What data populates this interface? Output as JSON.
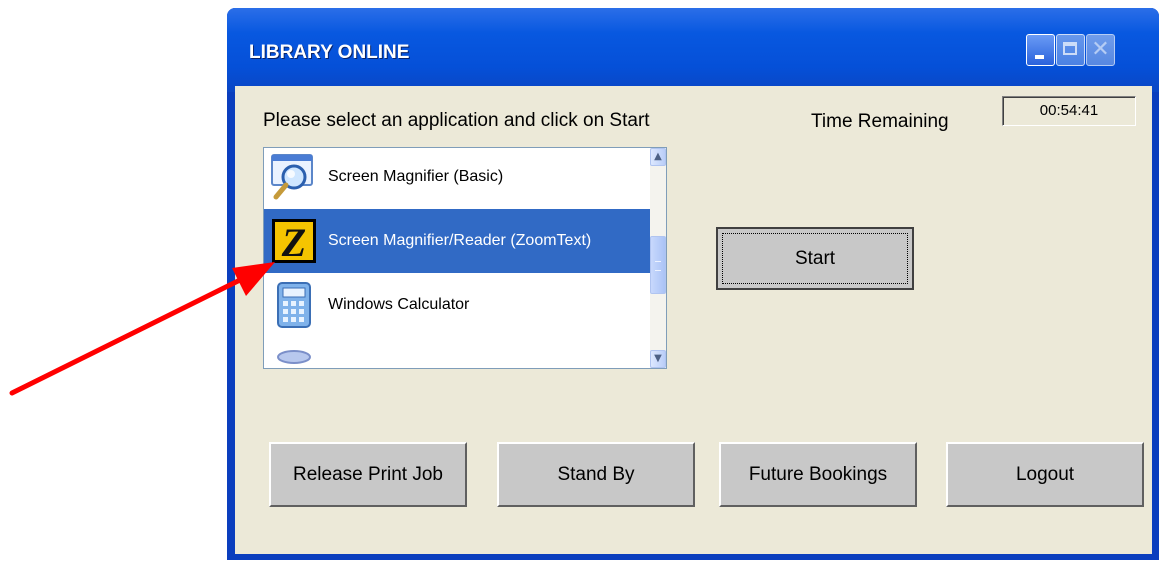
{
  "window": {
    "title": "LIBRARY ONLINE"
  },
  "client": {
    "prompt": "Please select an application and click on Start",
    "time_label": "Time Remaining",
    "time_value": "00:54:41"
  },
  "app_list": {
    "items": [
      {
        "label": "Screen Magnifier (Basic)",
        "icon": "magnifier-icon",
        "selected": false
      },
      {
        "label": "Screen Magnifier/Reader (ZoomText)",
        "icon": "zoomtext-icon",
        "selected": true
      },
      {
        "label": "Windows Calculator",
        "icon": "calculator-icon",
        "selected": false
      }
    ]
  },
  "buttons": {
    "start": "Start",
    "release_print_job": "Release Print Job",
    "stand_by": "Stand By",
    "future_bookings": "Future Bookings",
    "logout": "Logout"
  },
  "colors": {
    "titlebar": "#0550d8",
    "selection": "#316ac5",
    "client_bg": "#ece9d8",
    "annotation_arrow": "#ff0000"
  }
}
